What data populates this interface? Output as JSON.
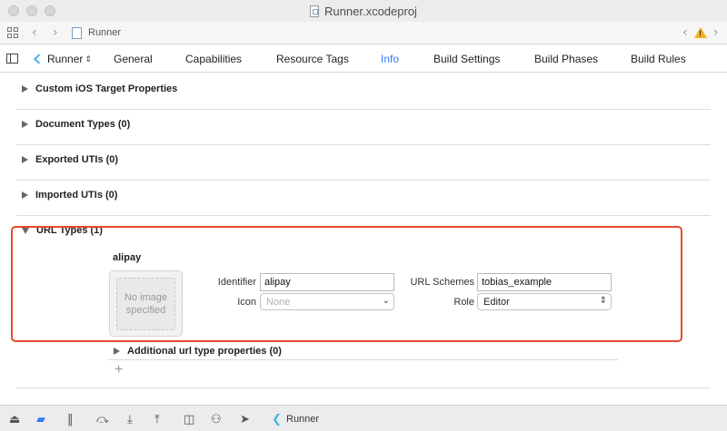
{
  "window": {
    "title": "Runner.xcodeproj"
  },
  "jumpbar": {
    "item": "Runner"
  },
  "tabbar": {
    "target": "Runner",
    "tabs": [
      {
        "label": "General"
      },
      {
        "label": "Capabilities"
      },
      {
        "label": "Resource Tags"
      },
      {
        "label": "Info",
        "active": true
      },
      {
        "label": "Build Settings"
      },
      {
        "label": "Build Phases"
      },
      {
        "label": "Build Rules"
      }
    ]
  },
  "sections": [
    {
      "label": "Custom iOS Target Properties",
      "expanded": false
    },
    {
      "label": "Document Types (0)",
      "expanded": false
    },
    {
      "label": "Exported UTIs (0)",
      "expanded": false
    },
    {
      "label": "Imported UTIs (0)",
      "expanded": false
    },
    {
      "label": "URL Types (1)",
      "expanded": true
    }
  ],
  "url_type": {
    "name": "alipay",
    "image_placeholder": "No image specified",
    "identifier_label": "Identifier",
    "identifier_value": "alipay",
    "icon_label": "Icon",
    "icon_value": "None",
    "url_schemes_label": "URL Schemes",
    "url_schemes_value": "tobias_example",
    "role_label": "Role",
    "role_value": "Editor",
    "additional": "Additional url type properties (0)"
  },
  "debugbar": {
    "scheme": "Runner"
  },
  "colors": {
    "accent": "#2f7cf6",
    "highlight": "#e8472c",
    "warning": "#f3b21b"
  }
}
